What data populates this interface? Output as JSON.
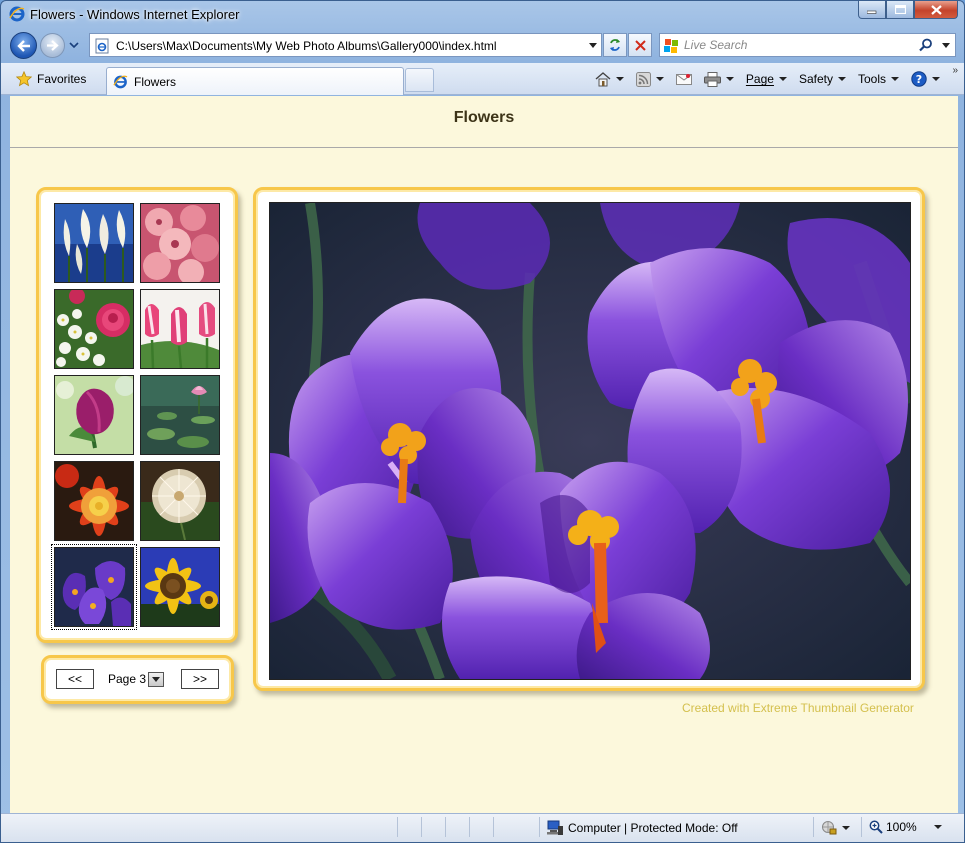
{
  "window": {
    "title": "Flowers - Windows Internet Explorer"
  },
  "nav": {
    "url": "C:\\Users\\Max\\Documents\\My Web Photo Albums\\Gallery000\\index.html",
    "search_placeholder": "Live Search"
  },
  "commandbar": {
    "favorites_label": "Favorites",
    "tab_title": "Flowers",
    "page_label": "Page",
    "safety_label": "Safety",
    "tools_label": "Tools"
  },
  "page": {
    "title": "Flowers",
    "pager": {
      "prev_label": "<<",
      "next_label": ">>",
      "current_page_label": "Page 3"
    },
    "credit": "Created with Extreme Thumbnail Generator",
    "thumbnails": [
      {
        "name": "thumb-white-lilies",
        "colors": [
          "#1a3a8a",
          "#f4f2e6"
        ]
      },
      {
        "name": "thumb-pink-gladiolus",
        "colors": [
          "#d0607a",
          "#f3b4b8"
        ]
      },
      {
        "name": "thumb-white-flowers-red-rose",
        "colors": [
          "#e6efe3",
          "#d6275e"
        ]
      },
      {
        "name": "thumb-pink-tulips",
        "colors": [
          "#e14a79",
          "#f7f3f3"
        ]
      },
      {
        "name": "thumb-purple-tulip",
        "colors": [
          "#9a1f6a",
          "#c4e0a6"
        ]
      },
      {
        "name": "thumb-water-lily",
        "colors": [
          "#2d5a4a",
          "#e48ab5"
        ]
      },
      {
        "name": "thumb-red-dahlia",
        "colors": [
          "#d83414",
          "#f4c43a"
        ]
      },
      {
        "name": "thumb-dandelion-puff",
        "colors": [
          "#3d2a1a",
          "#eee7d6"
        ]
      },
      {
        "name": "thumb-purple-crocus",
        "colors": [
          "#3d1e8a",
          "#8a56d8"
        ],
        "selected": true
      },
      {
        "name": "thumb-sunflower",
        "colors": [
          "#2b40b8",
          "#f4c214"
        ]
      }
    ]
  },
  "status": {
    "zone_text": "Computer | Protected Mode: Off",
    "zoom_text": "100%"
  }
}
